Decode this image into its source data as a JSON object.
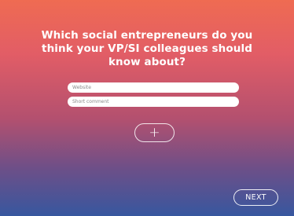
{
  "question": {
    "text": "Which social entrepreneurs do you think your VP/SI colleagues should know about?"
  },
  "form": {
    "website_placeholder": "Website",
    "website_value": "",
    "comment_placeholder": "Short comment",
    "comment_value": ""
  },
  "buttons": {
    "add_label": "+",
    "next_label": "NEXT"
  },
  "colors": {
    "gradient_top": "#ef6b52",
    "gradient_bottom": "#37579f",
    "text": "#ffffff"
  }
}
